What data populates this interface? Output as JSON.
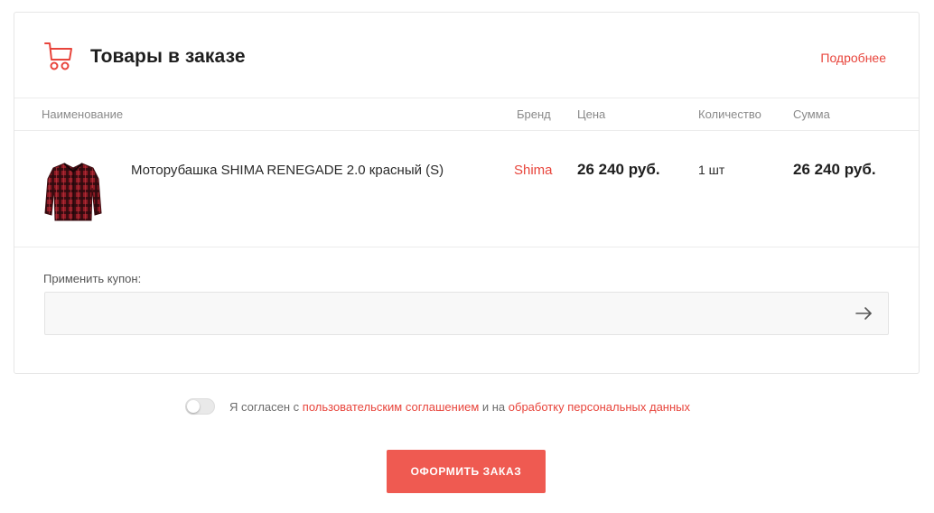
{
  "order": {
    "title": "Товары в заказе",
    "more_link": "Подробнее",
    "columns": {
      "name": "Наименование",
      "brand": "Бренд",
      "price": "Цена",
      "quantity": "Количество",
      "sum": "Сумма"
    },
    "items": [
      {
        "name": "Моторубашка SHIMA RENEGADE 2.0 красный (S)",
        "brand": "Shima",
        "price": "26 240 руб.",
        "quantity": "1 шт",
        "sum": "26 240 руб.",
        "image_icon": "red-plaid-shirt-image"
      }
    ],
    "coupon": {
      "label": "Применить купон:",
      "value": "",
      "placeholder": ""
    }
  },
  "agreement": {
    "checked": false,
    "text_1": "Я согласен с ",
    "link_1": "пользовательским соглашением",
    "text_2": " и на ",
    "link_2": "обработку персональных данных"
  },
  "submit_label": "Оформить заказ",
  "colors": {
    "accent": "#e8453c",
    "button": "#ef5a51"
  }
}
